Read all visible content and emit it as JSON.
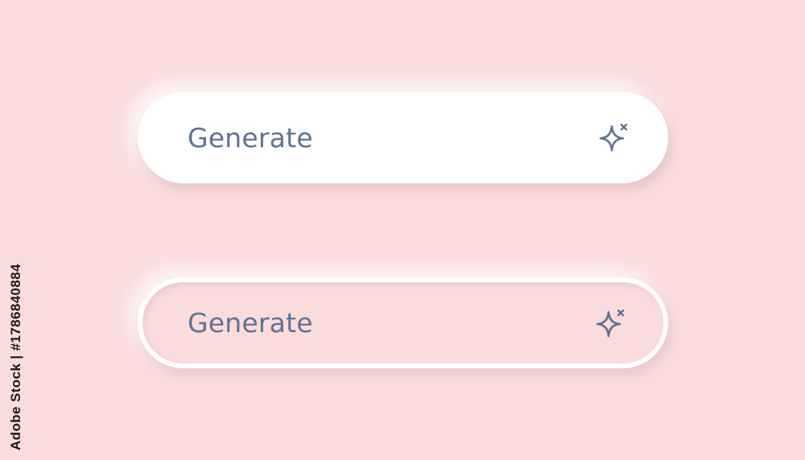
{
  "buttons": [
    {
      "label": "Generate",
      "icon": "sparkle-icon",
      "style": "raised"
    },
    {
      "label": "Generate",
      "icon": "sparkle-icon",
      "style": "pressed"
    }
  ],
  "watermark": {
    "text": "Adobe Stock | #1786840884"
  },
  "colors": {
    "background": "#fbdcdd",
    "button_raised": "#ffffff",
    "text": "#5f7391"
  }
}
